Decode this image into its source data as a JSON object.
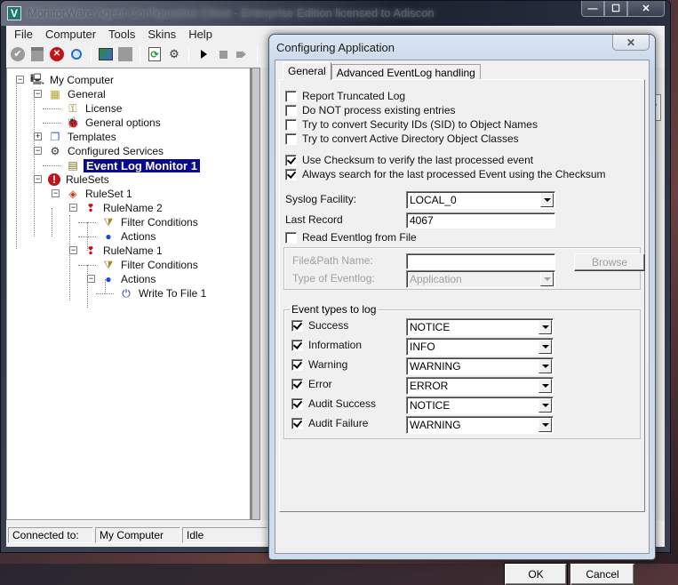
{
  "main_window": {
    "title": "MonitorWare Agent Configuration Client - Enterprise Edition licensed to Adiscon",
    "app_icon_glyph": "V",
    "controls": {
      "minimize": "—",
      "maximize": "☐",
      "close": "✕"
    },
    "menu": [
      "File",
      "Computer",
      "Tools",
      "Skins",
      "Help"
    ],
    "toolbar": [
      {
        "name": "apply-icon",
        "glyph": "✔"
      },
      {
        "name": "save-icon",
        "glyph": "▭"
      },
      {
        "name": "cancel-icon",
        "glyph": "✕"
      },
      {
        "name": "find-icon",
        "glyph": "🔍"
      },
      {
        "name": "computer-connect-icon",
        "glyph": "▣"
      },
      {
        "name": "disabled-tool-icon",
        "glyph": "■"
      },
      {
        "name": "refresh-icon",
        "glyph": "⟳"
      },
      {
        "name": "service-icon",
        "glyph": "⚙"
      },
      {
        "name": "start-icon",
        "glyph": "▶"
      },
      {
        "name": "stop-icon",
        "glyph": "■"
      },
      {
        "name": "step-icon",
        "glyph": "▶"
      }
    ],
    "tree": [
      {
        "label": "My Computer",
        "icon": "computer-icon",
        "glyph": "🖳",
        "level": 0,
        "toggle": "−"
      },
      {
        "label": "General",
        "icon": "general-icon",
        "glyph": "▦",
        "level": 1,
        "toggle": "−"
      },
      {
        "label": "License",
        "icon": "key-icon",
        "glyph": "⚿",
        "level": 2,
        "toggle": ""
      },
      {
        "label": "General options",
        "icon": "bug-icon",
        "glyph": "🐞",
        "level": 2,
        "toggle": ""
      },
      {
        "label": "Templates",
        "icon": "templates-icon",
        "glyph": "❐",
        "level": 1,
        "toggle": "+"
      },
      {
        "label": "Configured Services",
        "icon": "services-icon",
        "glyph": "⚙",
        "level": 1,
        "toggle": "−"
      },
      {
        "label": "Event Log Monitor 1",
        "icon": "eventlog-icon",
        "glyph": "▤",
        "level": 2,
        "toggle": "",
        "selected": true
      },
      {
        "label": "RuleSets",
        "icon": "rulesets-icon",
        "glyph": "!",
        "level": 1,
        "toggle": "−"
      },
      {
        "label": "RuleSet 1",
        "icon": "ruleset-icon",
        "glyph": "◈",
        "level": 2,
        "toggle": "−"
      },
      {
        "label": "RuleName 2",
        "icon": "rule-icon",
        "glyph": "❢",
        "level": 3,
        "toggle": "−"
      },
      {
        "label": "Filter Conditions",
        "icon": "filter-icon",
        "glyph": "⧩",
        "level": 4,
        "toggle": ""
      },
      {
        "label": "Actions",
        "icon": "actions-icon",
        "glyph": "●",
        "level": 4,
        "toggle": ""
      },
      {
        "label": "RuleName 1",
        "icon": "rule-icon",
        "glyph": "❢",
        "level": 3,
        "toggle": "−"
      },
      {
        "label": "Filter Conditions",
        "icon": "filter-icon",
        "glyph": "⧩",
        "level": 4,
        "toggle": ""
      },
      {
        "label": "Actions",
        "icon": "actions-icon",
        "glyph": "●",
        "level": 4,
        "toggle": "−"
      },
      {
        "label": "Write To File 1",
        "icon": "write-file-icon",
        "glyph": "⏻",
        "level": 5,
        "toggle": ""
      }
    ],
    "status": {
      "connected_label": "Connected to:",
      "computer": "My Computer",
      "state": "Idle"
    },
    "help_glyph": "?"
  },
  "dialog": {
    "title": "Configuring Application",
    "close_glyph": "✕",
    "tabs": [
      {
        "label": "General",
        "active": true
      },
      {
        "label": "Advanced EventLog handling",
        "active": false
      }
    ],
    "options": [
      {
        "label": "Report Truncated Log",
        "checked": false
      },
      {
        "label": "Do NOT process existing entries",
        "checked": false
      },
      {
        "label": "Try to convert Security IDs (SID) to Object Names",
        "checked": false
      },
      {
        "label": "Try to convert Active Directory Object Classes",
        "checked": false
      }
    ],
    "checksum_options": [
      {
        "label": "Use Checksum to verify the last processed event",
        "checked": true
      },
      {
        "label": "Always search for the last processed Event using the Checksum",
        "checked": true
      }
    ],
    "syslog_facility": {
      "label": "Syslog Facility:",
      "value": "LOCAL_0"
    },
    "last_record": {
      "label": "Last Record",
      "value": "4067"
    },
    "read_from_file": {
      "label": "Read Eventlog from File",
      "checked": false
    },
    "file_path": {
      "label": "File&Path Name:",
      "value": "",
      "browse_label": "Browse"
    },
    "eventlog_type": {
      "label": "Type of Eventlog:",
      "value": "Application"
    },
    "event_types": {
      "legend": "Event types to log",
      "items": [
        {
          "label": "Success",
          "checked": true,
          "value": "NOTICE"
        },
        {
          "label": "Information",
          "checked": true,
          "value": "INFO"
        },
        {
          "label": "Warning",
          "checked": true,
          "value": "WARNING"
        },
        {
          "label": "Error",
          "checked": true,
          "value": "ERROR"
        },
        {
          "label": "Audit Success",
          "checked": true,
          "value": "NOTICE"
        },
        {
          "label": "Audit Failure",
          "checked": true,
          "value": "WARNING"
        }
      ]
    },
    "ok_label": "OK",
    "cancel_label": "Cancel"
  }
}
